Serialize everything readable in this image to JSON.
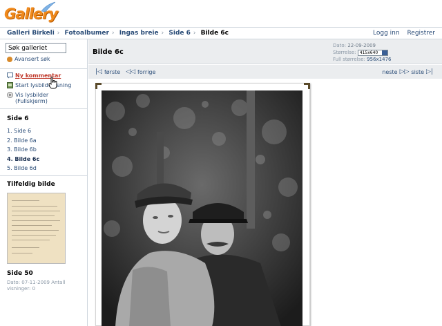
{
  "app": {
    "logo_text": "Gallery"
  },
  "breadcrumb": [
    "Galleri Birkeli",
    "Fotoalbumer",
    "Ingas breie",
    "Side 6",
    "Bilde 6c"
  ],
  "auth": {
    "login": "Logg inn",
    "register": "Registrer"
  },
  "sidebar": {
    "search": {
      "value": "Søk galleriet"
    },
    "advanced_search": "Avansert søk",
    "actions": [
      {
        "label": "Ny kommentar",
        "icon": "comment-icon"
      },
      {
        "label": "Start lysbildevisning",
        "icon": "slideshow-icon"
      },
      {
        "label": "Vis lysbilder (Fullskjerm)",
        "icon": "play-icon"
      }
    ],
    "album_title": "Side 6",
    "album_items": [
      "1. Side 6",
      "2. Bilde 6a",
      "3. Bilde 6b",
      "4. Bilde 6c",
      "5. Bilde 6d"
    ],
    "random_title": "Tilfeldig bilde",
    "random_caption": "Side 50",
    "random_meta": "Dato: 07-11-2009 Antall visninger: 0"
  },
  "main": {
    "title": "Bilde 6c",
    "date_label": "Dato:",
    "date_value": "22-09-2009",
    "size_label": "Størrelse:",
    "size_value": "415x640",
    "fullsize_label": "Full størrelse:",
    "fullsize_value": "956x1476"
  },
  "nav": {
    "first": "første",
    "prev": "forrige",
    "next": "neste",
    "last": "siste"
  },
  "colors": {
    "logo": "#f08a1c",
    "link": "#2b4d78",
    "header_bg": "#ebedef",
    "hot": "#c0392b"
  }
}
